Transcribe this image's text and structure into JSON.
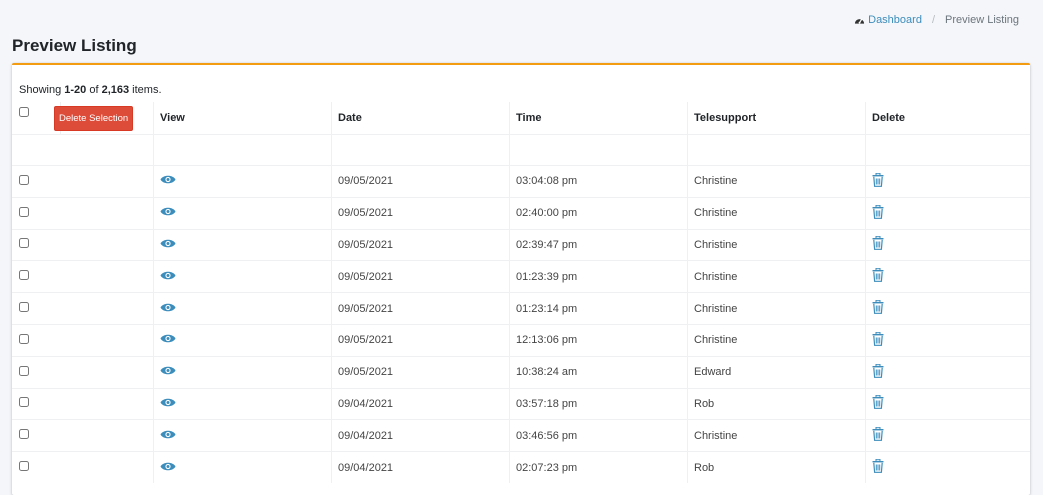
{
  "colors": {
    "accent": "#f39c12",
    "link": "#3c8dbc",
    "danger": "#dd4b39"
  },
  "breadcrumb": {
    "home_icon": "tachometer-icon",
    "home": "Dashboard",
    "current": "Preview Listing"
  },
  "page": {
    "title": "Preview Listing"
  },
  "summary": {
    "prefix": "Showing ",
    "range": "1-20",
    "of": " of ",
    "total": "2,163",
    "suffix": " items."
  },
  "table": {
    "delete_selection_label": "Delete Selection",
    "headers": {
      "view": "View",
      "date": "Date",
      "time": "Time",
      "telesupport": "Telesupport",
      "delete": "Delete"
    },
    "view_icon": "eye-icon",
    "delete_icon": "trash-icon",
    "rows": [
      {
        "date": "09/05/2021",
        "time": "03:04:08 pm",
        "telesupport": "Christine"
      },
      {
        "date": "09/05/2021",
        "time": "02:40:00 pm",
        "telesupport": "Christine"
      },
      {
        "date": "09/05/2021",
        "time": "02:39:47 pm",
        "telesupport": "Christine"
      },
      {
        "date": "09/05/2021",
        "time": "01:23:39 pm",
        "telesupport": "Christine"
      },
      {
        "date": "09/05/2021",
        "time": "01:23:14 pm",
        "telesupport": "Christine"
      },
      {
        "date": "09/05/2021",
        "time": "12:13:06 pm",
        "telesupport": "Christine"
      },
      {
        "date": "09/05/2021",
        "time": "10:38:24 am",
        "telesupport": "Edward"
      },
      {
        "date": "09/04/2021",
        "time": "03:57:18 pm",
        "telesupport": "Rob"
      },
      {
        "date": "09/04/2021",
        "time": "03:46:56 pm",
        "telesupport": "Christine"
      },
      {
        "date": "09/04/2021",
        "time": "02:07:23 pm",
        "telesupport": "Rob"
      }
    ]
  }
}
